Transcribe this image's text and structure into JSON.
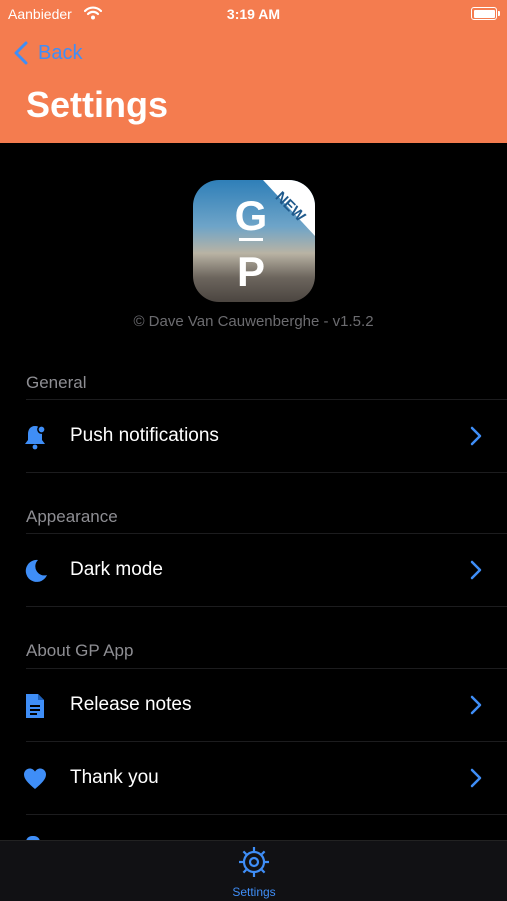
{
  "status_bar": {
    "carrier": "Aanbieder",
    "time": "3:19 AM"
  },
  "nav": {
    "back_label": "Back",
    "title": "Settings"
  },
  "app_icon": {
    "logo_text": "G P",
    "badge": "NEW"
  },
  "copyright": "© Dave Van Cauwenberghe - v1.5.2",
  "sections": [
    {
      "header": "General",
      "items": [
        {
          "label": "Push notifications",
          "icon": "bell-icon"
        }
      ]
    },
    {
      "header": "Appearance",
      "items": [
        {
          "label": "Dark mode",
          "icon": "moon-icon"
        }
      ]
    },
    {
      "header": "About GP App",
      "items": [
        {
          "label": "Release notes",
          "icon": "document-icon"
        },
        {
          "label": "Thank you",
          "icon": "heart-icon"
        }
      ]
    }
  ],
  "tab_bar": {
    "settings_label": "Settings"
  },
  "colors": {
    "header_bg": "#f47c4f",
    "accent": "#3f8ef7",
    "background": "#000000"
  }
}
